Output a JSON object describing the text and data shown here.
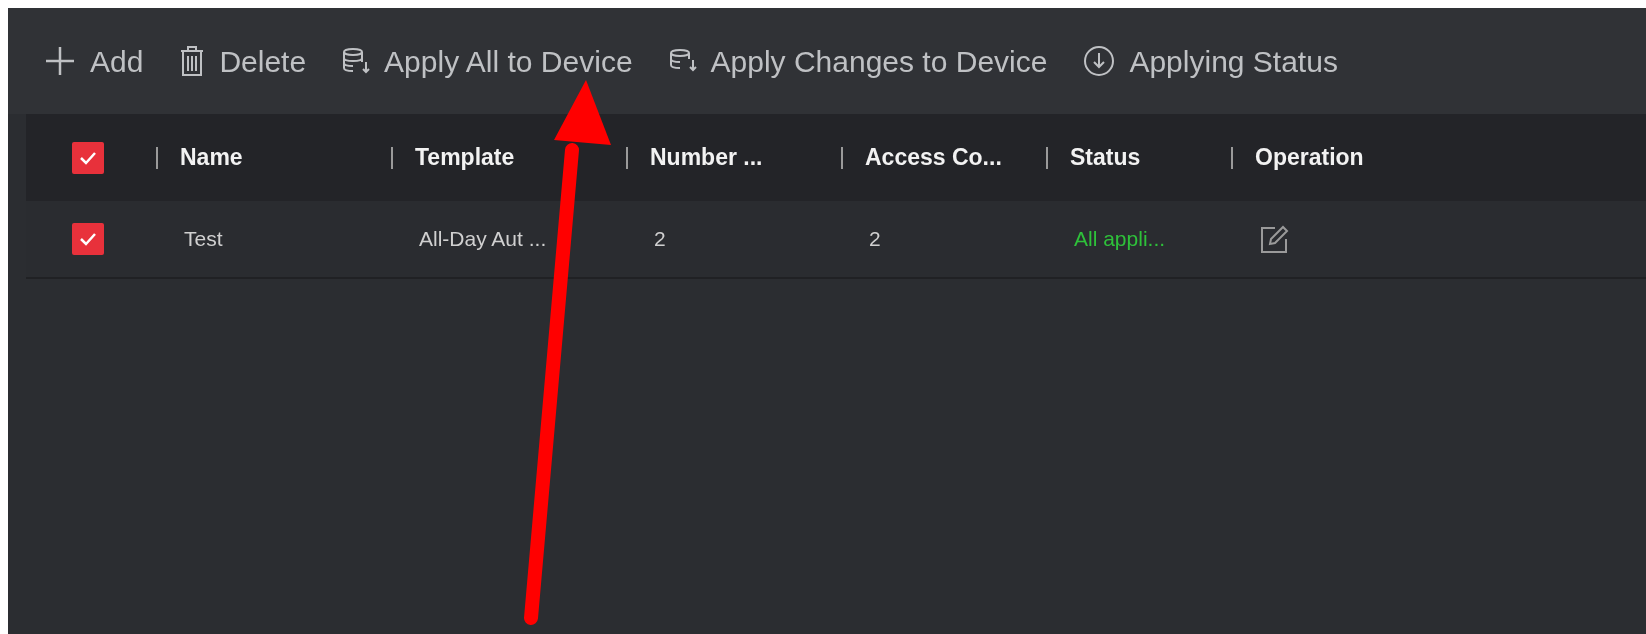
{
  "toolbar": [
    {
      "kind": "plus",
      "label": "Add"
    },
    {
      "kind": "trash",
      "label": "Delete"
    },
    {
      "kind": "database",
      "label": "Apply All to Device"
    },
    {
      "kind": "database-small",
      "label": "Apply Changes to Device"
    },
    {
      "kind": "download-circle",
      "label": "Applying Status"
    }
  ],
  "table": {
    "select_all": {
      "checked": true
    },
    "columns": [
      "Name",
      "Template",
      "Number ...",
      "Access Co...",
      "Status",
      "Operation"
    ],
    "rows": [
      {
        "checked": true,
        "cells": [
          "Test",
          "All-Day Aut ...",
          "2",
          "2",
          "All appli..."
        ]
      }
    ]
  }
}
